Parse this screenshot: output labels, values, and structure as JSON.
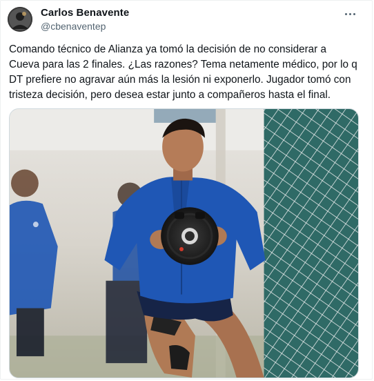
{
  "author": {
    "name": "Carlos Benavente",
    "handle": "@cbenaventep",
    "avatar_icon": "profile-avatar"
  },
  "menu": {
    "icon": "more-horizontal-icon"
  },
  "tweet": {
    "lines": [
      "Comando técnico de Alianza ya tomó la decisión de no considerar a",
      "Cueva para las 2 finales. ¿Las razones? Tema netamente médico, por lo q",
      "DT prefiere no agravar aún más la lesión ni exponerlo. Jugador tomó con",
      "tristeza decisión, pero desea estar junto a compañeros hasta el final."
    ]
  },
  "media": {
    "type": "photo"
  },
  "colors": {
    "text": "#0f1419",
    "secondary": "#536471",
    "jersey": "#1f57b5"
  }
}
